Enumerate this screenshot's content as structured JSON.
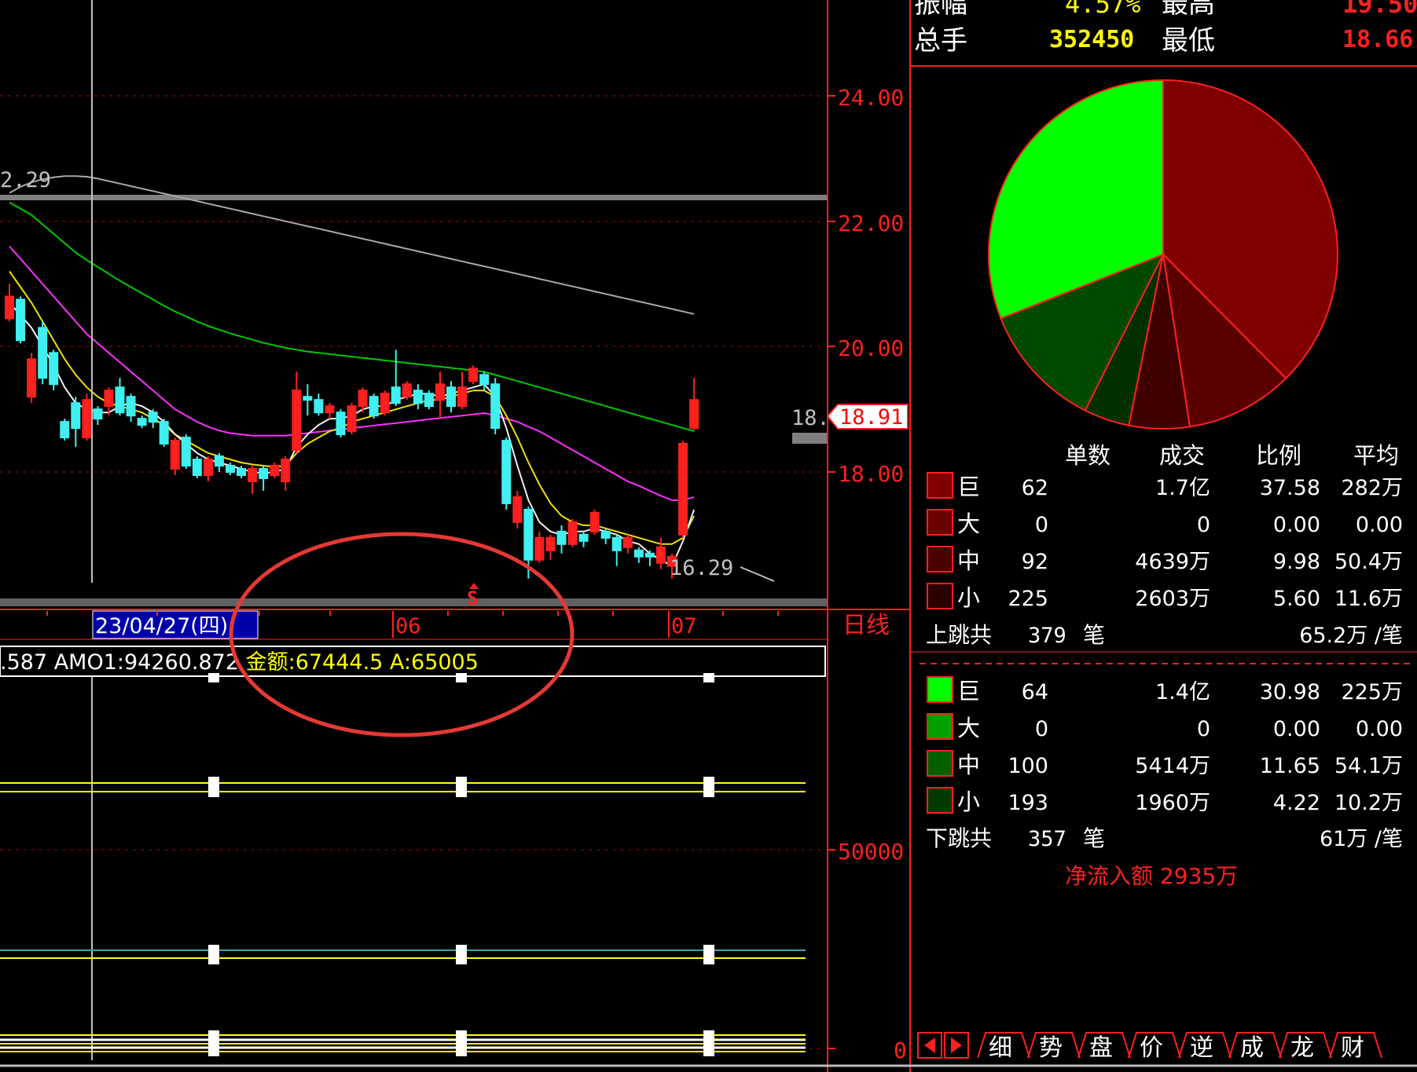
{
  "quote_header": {
    "amplitude_label": "振幅",
    "amplitude_value": "4.57%",
    "high_label": "最高",
    "high_value": "19.50",
    "volume_label": "总手",
    "volume_value": "352450",
    "low_label": "最低",
    "low_value": "18.66"
  },
  "price_axis": {
    "ticks": [
      "24.00",
      "22.00",
      "20.00",
      "18.00"
    ],
    "current_price": "18.91"
  },
  "chart_labels": {
    "ma_left_value": "2.29",
    "low_marker": "16.29",
    "last_close_marker": "18.",
    "signal_marker": "S",
    "cursor_date": "23/04/27(四)",
    "month_06": "06",
    "month_07": "07",
    "period": "日线"
  },
  "indicator": {
    "readout_prefix": ".587 AMO1:94260.872 ",
    "readout_amount": "金额:67444.5 A:65005",
    "axis_50000": "50000",
    "axis_0": "0"
  },
  "pie": {
    "slices": [
      {
        "name": "巨",
        "side": "up",
        "value": 37.58,
        "color": "#800000"
      },
      {
        "name": "大",
        "side": "up",
        "value": 0.0,
        "color": "#700000"
      },
      {
        "name": "中",
        "side": "up",
        "value": 9.98,
        "color": "#5a0000"
      },
      {
        "name": "小",
        "side": "up",
        "value": 5.6,
        "color": "#400000"
      },
      {
        "name": "小",
        "side": "down",
        "value": 4.22,
        "color": "#003000"
      },
      {
        "name": "中",
        "side": "down",
        "value": 11.65,
        "color": "#004a00"
      },
      {
        "name": "大",
        "side": "down",
        "value": 0.0,
        "color": "#006000"
      },
      {
        "name": "巨",
        "side": "down",
        "value": 30.98,
        "color": "#00ff00"
      }
    ]
  },
  "flow_table": {
    "headers": [
      "单数",
      "成交",
      "比例",
      "平均"
    ],
    "up_rows": [
      {
        "size": "巨",
        "count": "62",
        "amount": "1.7亿",
        "ratio": "37.58",
        "avg": "282万",
        "color": "#800000"
      },
      {
        "size": "大",
        "count": "0",
        "amount": "0",
        "ratio": "0.00",
        "avg": "0.00",
        "color": "#6a0000"
      },
      {
        "size": "中",
        "count": "92",
        "amount": "4639万",
        "ratio": "9.98",
        "avg": "50.4万",
        "color": "#4a0000"
      },
      {
        "size": "小",
        "count": "225",
        "amount": "2603万",
        "ratio": "5.60",
        "avg": "11.6万",
        "color": "#2a0000"
      }
    ],
    "up_total_label": "上跳共",
    "up_total_count": "379",
    "up_total_unit": "笔",
    "up_total_avg": "65.2万 /笔",
    "down_rows": [
      {
        "size": "巨",
        "count": "64",
        "amount": "1.4亿",
        "ratio": "30.98",
        "avg": "225万",
        "color": "#00ff00"
      },
      {
        "size": "大",
        "count": "0",
        "amount": "0",
        "ratio": "0.00",
        "avg": "0.00",
        "color": "#00a000"
      },
      {
        "size": "中",
        "count": "100",
        "amount": "5414万",
        "ratio": "11.65",
        "avg": "54.1万",
        "color": "#006000"
      },
      {
        "size": "小",
        "count": "193",
        "amount": "1960万",
        "ratio": "4.22",
        "avg": "10.2万",
        "color": "#003a00"
      }
    ],
    "down_total_label": "下跳共",
    "down_total_count": "357",
    "down_total_unit": "笔",
    "down_total_avg": "61万 /笔",
    "net_inflow": "净流入额 2935万"
  },
  "tabs": [
    "细",
    "势",
    "盘",
    "价",
    "逆",
    "成",
    "龙",
    "财"
  ],
  "nav": {
    "prev": "◀",
    "next": "▶"
  },
  "candles": [
    {
      "o": 20.45,
      "c": 20.8,
      "h": 21.0,
      "l": 20.4
    },
    {
      "o": 20.75,
      "c": 20.1,
      "h": 20.8,
      "l": 20.05
    },
    {
      "o": 19.2,
      "c": 19.8,
      "h": 19.9,
      "l": 19.1
    },
    {
      "o": 20.3,
      "c": 19.5,
      "h": 20.4,
      "l": 19.4
    },
    {
      "o": 19.9,
      "c": 19.4,
      "h": 19.95,
      "l": 19.3
    },
    {
      "o": 18.8,
      "c": 18.55,
      "h": 18.85,
      "l": 18.5
    },
    {
      "o": 19.1,
      "c": 18.7,
      "h": 19.2,
      "l": 18.4
    },
    {
      "o": 18.55,
      "c": 19.15,
      "h": 19.25,
      "l": 18.5
    },
    {
      "o": 19.0,
      "c": 18.85,
      "h": 19.05,
      "l": 18.75
    },
    {
      "o": 19.05,
      "c": 19.3,
      "h": 19.35,
      "l": 18.9
    },
    {
      "o": 19.35,
      "c": 18.95,
      "h": 19.5,
      "l": 18.9
    },
    {
      "o": 19.2,
      "c": 18.9,
      "h": 19.25,
      "l": 18.8
    },
    {
      "o": 18.85,
      "c": 18.75,
      "h": 18.9,
      "l": 18.7
    },
    {
      "o": 18.95,
      "c": 18.8,
      "h": 19.0,
      "l": 18.7
    },
    {
      "o": 18.8,
      "c": 18.45,
      "h": 18.85,
      "l": 18.4
    },
    {
      "o": 18.05,
      "c": 18.5,
      "h": 18.55,
      "l": 17.95
    },
    {
      "o": 18.55,
      "c": 18.1,
      "h": 18.6,
      "l": 18.05
    },
    {
      "o": 18.2,
      "c": 17.95,
      "h": 18.25,
      "l": 17.9
    },
    {
      "o": 17.95,
      "c": 18.2,
      "h": 18.25,
      "l": 17.85
    },
    {
      "o": 18.25,
      "c": 18.1,
      "h": 18.3,
      "l": 18.0
    },
    {
      "o": 18.1,
      "c": 18.0,
      "h": 18.15,
      "l": 17.95
    },
    {
      "o": 18.05,
      "c": 17.95,
      "h": 18.1,
      "l": 17.9
    },
    {
      "o": 17.85,
      "c": 18.05,
      "h": 18.1,
      "l": 17.65
    },
    {
      "o": 18.05,
      "c": 17.9,
      "h": 18.1,
      "l": 17.7
    },
    {
      "o": 17.95,
      "c": 18.1,
      "h": 18.15,
      "l": 17.9
    },
    {
      "o": 17.85,
      "c": 18.2,
      "h": 18.25,
      "l": 17.7
    },
    {
      "o": 18.35,
      "c": 19.3,
      "h": 19.6,
      "l": 18.3
    },
    {
      "o": 19.2,
      "c": 19.15,
      "h": 19.4,
      "l": 18.9
    },
    {
      "o": 19.15,
      "c": 18.95,
      "h": 19.25,
      "l": 18.9
    },
    {
      "o": 18.95,
      "c": 19.05,
      "h": 19.1,
      "l": 18.85
    },
    {
      "o": 18.95,
      "c": 18.6,
      "h": 19.0,
      "l": 18.55
    },
    {
      "o": 18.65,
      "c": 19.05,
      "h": 19.1,
      "l": 18.6
    },
    {
      "o": 19.05,
      "c": 19.3,
      "h": 19.35,
      "l": 18.95
    },
    {
      "o": 19.2,
      "c": 18.9,
      "h": 19.25,
      "l": 18.85
    },
    {
      "o": 18.95,
      "c": 19.25,
      "h": 19.3,
      "l": 18.9
    },
    {
      "o": 19.35,
      "c": 19.1,
      "h": 19.95,
      "l": 19.05
    },
    {
      "o": 19.2,
      "c": 19.4,
      "h": 19.45,
      "l": 19.15
    },
    {
      "o": 19.3,
      "c": 19.1,
      "h": 19.4,
      "l": 19.0
    },
    {
      "o": 19.25,
      "c": 19.05,
      "h": 19.3,
      "l": 19.0
    },
    {
      "o": 19.15,
      "c": 19.4,
      "h": 19.6,
      "l": 18.85
    },
    {
      "o": 19.35,
      "c": 19.05,
      "h": 19.45,
      "l": 18.95
    },
    {
      "o": 19.05,
      "c": 19.35,
      "h": 19.6,
      "l": 19.0
    },
    {
      "o": 19.45,
      "c": 19.65,
      "h": 19.7,
      "l": 19.4
    },
    {
      "o": 19.55,
      "c": 19.4,
      "h": 19.6,
      "l": 19.3
    },
    {
      "o": 19.4,
      "c": 18.7,
      "h": 19.5,
      "l": 18.6
    },
    {
      "o": 18.5,
      "c": 17.5,
      "h": 18.55,
      "l": 17.4
    },
    {
      "o": 17.2,
      "c": 17.6,
      "h": 17.7,
      "l": 17.1
    },
    {
      "o": 17.4,
      "c": 16.6,
      "h": 17.45,
      "l": 16.3
    },
    {
      "o": 16.6,
      "c": 16.95,
      "h": 17.05,
      "l": 16.55
    },
    {
      "o": 16.75,
      "c": 16.95,
      "h": 17.0,
      "l": 16.6
    },
    {
      "o": 17.05,
      "c": 16.85,
      "h": 17.15,
      "l": 16.7
    },
    {
      "o": 16.85,
      "c": 17.2,
      "h": 17.25,
      "l": 16.8
    },
    {
      "o": 17.0,
      "c": 16.9,
      "h": 17.05,
      "l": 16.8
    },
    {
      "o": 17.05,
      "c": 17.35,
      "h": 17.4,
      "l": 17.0
    },
    {
      "o": 17.05,
      "c": 16.95,
      "h": 17.1,
      "l": 16.85
    },
    {
      "o": 16.95,
      "c": 16.75,
      "h": 17.0,
      "l": 16.5
    },
    {
      "o": 16.8,
      "c": 16.95,
      "h": 17.0,
      "l": 16.7
    },
    {
      "o": 16.75,
      "c": 16.65,
      "h": 16.8,
      "l": 16.55
    },
    {
      "o": 16.7,
      "c": 16.65,
      "h": 16.75,
      "l": 16.5
    },
    {
      "o": 16.55,
      "c": 16.8,
      "h": 16.95,
      "l": 16.45
    },
    {
      "o": 16.5,
      "c": 16.65,
      "h": 16.7,
      "l": 16.3
    },
    {
      "o": 17.0,
      "c": 18.45,
      "h": 18.5,
      "l": 16.95
    },
    {
      "o": 18.7,
      "c": 19.15,
      "h": 19.5,
      "l": 18.66
    }
  ],
  "ma": {
    "white": [
      20.7,
      20.5,
      20.3,
      20.0,
      19.7,
      19.35,
      19.1,
      19.0,
      18.95,
      18.95,
      19.05,
      19.1,
      19.05,
      18.95,
      18.8,
      18.6,
      18.45,
      18.3,
      18.2,
      18.15,
      18.1,
      18.05,
      18.0,
      17.98,
      18.0,
      18.05,
      18.4,
      18.6,
      18.75,
      18.85,
      18.85,
      18.9,
      19.0,
      19.05,
      19.05,
      19.15,
      19.2,
      19.25,
      19.25,
      19.2,
      19.25,
      19.3,
      19.35,
      19.4,
      19.2,
      18.7,
      18.1,
      17.55,
      17.2,
      17.05,
      17.0,
      17.05,
      17.05,
      17.1,
      17.05,
      17.0,
      16.9,
      16.85,
      16.7,
      16.6,
      16.5,
      16.9,
      17.4
    ],
    "yellow": [
      21.2,
      20.95,
      20.7,
      20.4,
      20.1,
      19.8,
      19.55,
      19.35,
      19.2,
      19.1,
      19.05,
      19.0,
      18.95,
      18.85,
      18.75,
      18.6,
      18.5,
      18.4,
      18.3,
      18.25,
      18.2,
      18.15,
      18.12,
      18.1,
      18.08,
      18.1,
      18.3,
      18.45,
      18.55,
      18.65,
      18.7,
      18.8,
      18.85,
      18.9,
      18.95,
      19.0,
      19.05,
      19.1,
      19.15,
      19.15,
      19.2,
      19.25,
      19.3,
      19.3,
      19.2,
      18.9,
      18.55,
      18.15,
      17.8,
      17.5,
      17.3,
      17.2,
      17.15,
      17.15,
      17.1,
      17.05,
      17.0,
      16.95,
      16.9,
      16.85,
      16.85,
      16.95,
      17.3
    ],
    "magenta": [
      21.6,
      21.4,
      21.2,
      21.0,
      20.8,
      20.6,
      20.4,
      20.2,
      20.05,
      19.9,
      19.75,
      19.6,
      19.45,
      19.3,
      19.15,
      19.0,
      18.9,
      18.8,
      18.72,
      18.66,
      18.62,
      18.6,
      18.58,
      18.58,
      18.58,
      18.58,
      18.6,
      18.62,
      18.64,
      18.66,
      18.68,
      18.7,
      18.72,
      18.74,
      18.76,
      18.78,
      18.8,
      18.82,
      18.84,
      18.86,
      18.88,
      18.9,
      18.92,
      18.94,
      18.9,
      18.85,
      18.8,
      18.72,
      18.65,
      18.55,
      18.45,
      18.35,
      18.25,
      18.15,
      18.05,
      17.95,
      17.85,
      17.78,
      17.7,
      17.62,
      17.55,
      17.55,
      17.6
    ],
    "green": [
      22.3,
      22.2,
      22.1,
      21.95,
      21.8,
      21.65,
      21.5,
      21.38,
      21.27,
      21.16,
      21.05,
      20.95,
      20.85,
      20.75,
      20.65,
      20.56,
      20.48,
      20.4,
      20.33,
      20.27,
      20.21,
      20.16,
      20.11,
      20.06,
      20.02,
      19.98,
      19.95,
      19.92,
      19.9,
      19.88,
      19.86,
      19.84,
      19.82,
      19.8,
      19.78,
      19.76,
      19.74,
      19.72,
      19.7,
      19.68,
      19.66,
      19.64,
      19.62,
      19.6,
      19.55,
      19.5,
      19.45,
      19.4,
      19.35,
      19.3,
      19.25,
      19.2,
      19.15,
      19.1,
      19.05,
      19.0,
      18.95,
      18.9,
      18.85,
      18.8,
      18.75,
      18.7,
      18.65
    ],
    "gray": [
      22.45,
      22.55,
      22.62,
      22.67,
      22.7,
      22.72,
      22.72,
      22.71,
      22.68,
      22.64,
      22.6,
      22.56,
      22.52,
      22.48,
      22.44,
      22.4,
      22.36,
      22.32,
      22.28,
      22.24,
      22.2,
      22.16,
      22.12,
      22.08,
      22.04,
      22.0,
      21.96,
      21.92,
      21.88,
      21.84,
      21.8,
      21.76,
      21.72,
      21.68,
      21.64,
      21.6,
      21.56,
      21.52,
      21.48,
      21.44,
      21.4,
      21.36,
      21.32,
      21.28,
      21.24,
      21.2,
      21.16,
      21.12,
      21.08,
      21.04,
      21.0,
      20.96,
      20.92,
      20.88,
      20.84,
      20.8,
      20.76,
      20.72,
      20.68,
      20.64,
      20.6,
      20.56,
      20.52
    ]
  }
}
